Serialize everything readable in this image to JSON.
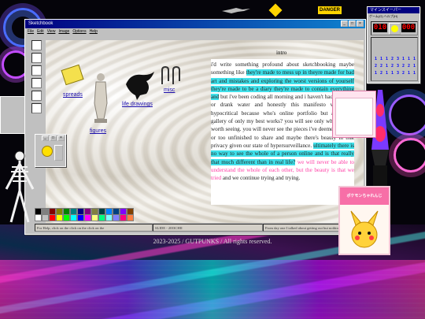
{
  "window": {
    "title": "Sketchbook",
    "menu": [
      "File",
      "Edit",
      "View",
      "Image",
      "Options",
      "Help"
    ]
  },
  "desktop_icons": {
    "spreads": "spreads",
    "life_drawings": "life drawings",
    "figures": "figures",
    "misc": "misc"
  },
  "intro_link": "intro",
  "post": {
    "p1": "i'd write something profound about sketchbooking maybe something like ",
    "p2": "they're made to mess up in theyre made for bad art and mistakes and exploring the worst versions of yourself they're made to be a diary they're made to contain everything and",
    "p3": " but i've been coding all morning and i haven't had anything or drank water and honestly this manifesto would be hypocritical because who's online portfolio but a curated gallery of only my best works? you will see only what i deem worth seeing. you will never see the pieces i've deemed too bad or too unfinished to share and maybe there's beauty in that privacy given our state of hypersurveillance. ",
    "p4": "ultimately there is no way to see the whole of a person online and is that really that much different than in real life?",
    "p5": " we will never be able to understand the whole of each other, but the beauty is that we tried",
    "p6": " and we continue trying and trying."
  },
  "status_bar": {
    "left": "For Help, click on the click on the click on the",
    "middle": "SLIDE - 20I3CHII",
    "right": "From day one I talked about getting out but nothing"
  },
  "minesweeper": {
    "title": "マインスイーパー",
    "menu": "ゲーム(G)   ヘルプ(H)",
    "mines_left": "010",
    "timer": "000",
    "numbers": [
      "1",
      "1",
      "1",
      "2",
      "3",
      "1",
      "1",
      "1",
      "2",
      "2",
      "1",
      "2",
      "3",
      "2",
      "2",
      "1",
      "1",
      "2",
      "1",
      "1",
      "3",
      "2",
      "1",
      "1"
    ]
  },
  "top_strip": {
    "warning_label": "DANGER"
  },
  "card": {
    "title": "ポケモンちゃれんじ"
  },
  "footer": "2023-2025 / GUTPUNKS / All rights reserved.",
  "palette_colors": [
    "#000000",
    "#808080",
    "#800000",
    "#808000",
    "#008000",
    "#008080",
    "#000080",
    "#800080",
    "#808040",
    "#004040",
    "#0080ff",
    "#004080",
    "#8000ff",
    "#804000",
    "#ffffff",
    "#c0c0c0",
    "#ff0000",
    "#ffff00",
    "#00ff00",
    "#00ffff",
    "#0000ff",
    "#ff00ff",
    "#ffff80",
    "#00ff80",
    "#80ffff",
    "#8080ff",
    "#ff0080",
    "#ff8040"
  ],
  "colors": {
    "highlight_cyan": "#3fe0ea",
    "highlight_pink": "#ff3da5",
    "title_bar": "#000080"
  }
}
